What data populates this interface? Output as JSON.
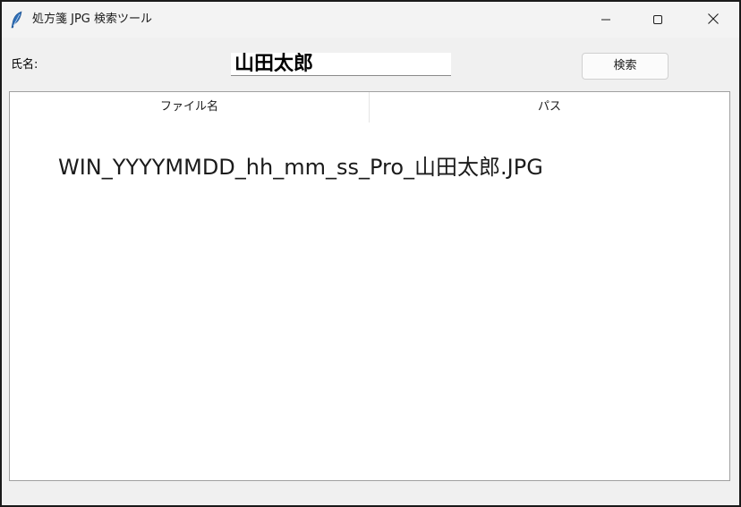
{
  "window": {
    "title": "処方箋 JPG 検索ツール",
    "app_icon": "feather-icon",
    "controls": {
      "minimize_icon": "minimize-icon",
      "maximize_icon": "maximize-icon",
      "close_icon": "close-icon"
    }
  },
  "form": {
    "name_label": "氏名:",
    "name_value": "山田太郎",
    "search_label": "検索"
  },
  "results": {
    "columns": [
      "ファイル名",
      "パス"
    ],
    "rows": [
      {
        "filename": "WIN_YYYYMMDD_hh_mm_ss_Pro_山田太郎.JPG",
        "path": ""
      }
    ]
  }
}
